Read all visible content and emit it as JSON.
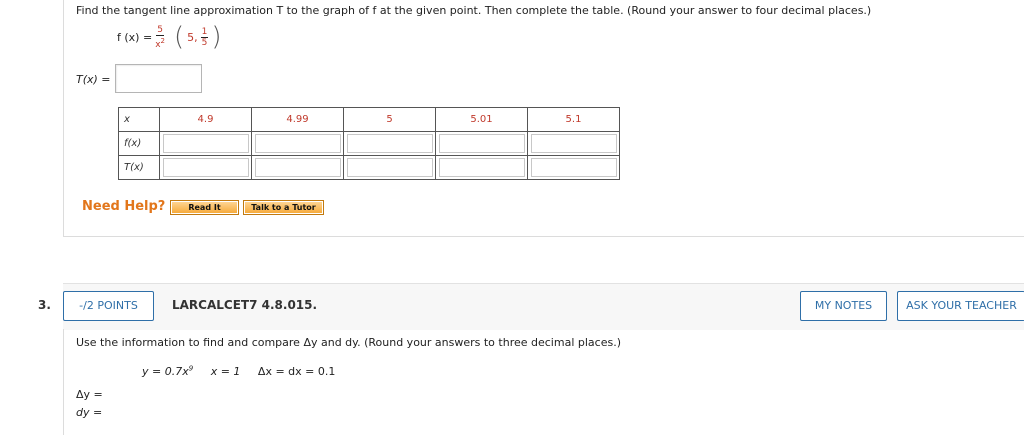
{
  "question1": {
    "instruction": "Find the tangent line approximation T to the graph of f at the given point. Then complete the table. (Round your answer to four decimal places.)",
    "function_lhs": "f (x) =",
    "function_num": "5",
    "function_den": "x",
    "function_den_exp": "2",
    "point_x": "5,",
    "point_num": "1",
    "point_den": "5",
    "tx_label": "T(x) =",
    "table": {
      "headers": [
        "x",
        "f(x)",
        "T(x)"
      ],
      "x_values": [
        "4.9",
        "4.99",
        "5",
        "5.01",
        "5.1"
      ]
    },
    "need_help": "Need Help?",
    "read_it": "Read It",
    "talk_tutor": "Talk to a Tutor"
  },
  "question2": {
    "number": "3.",
    "points": "-/2 POINTS",
    "title": "LARCALCET7 4.8.015.",
    "my_notes": "MY NOTES",
    "ask_teacher": "ASK YOUR TEACHER",
    "instruction": "Use the information to find and compare Δy and dy. (Round your answers to three decimal places.)",
    "eq_y": "y = 0.7x",
    "eq_y_exp": "9",
    "eq_x": "x = 1",
    "eq_dx": "Δx = dx = 0.1",
    "delta_y_label": "Δy =",
    "dy_label": "dy ="
  }
}
